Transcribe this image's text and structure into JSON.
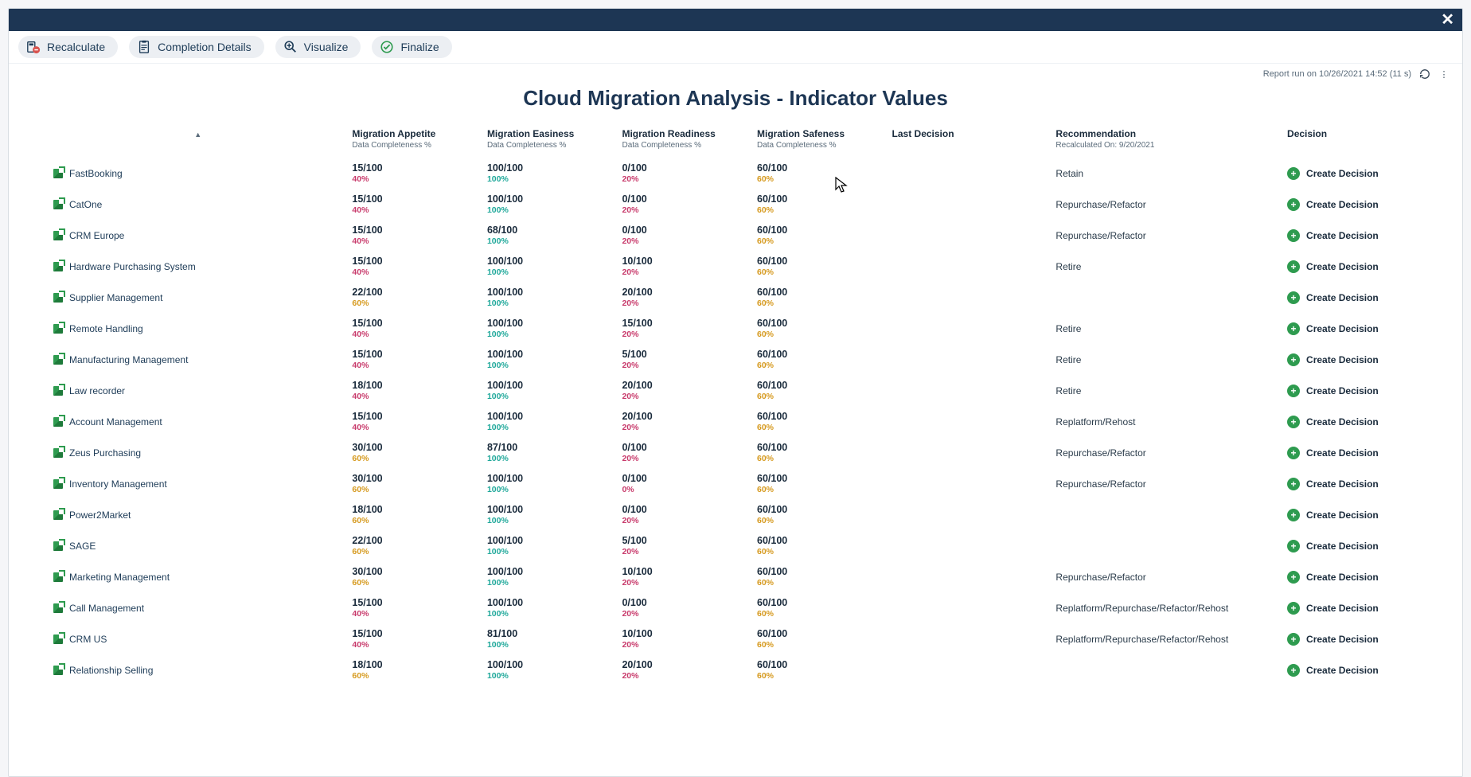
{
  "toolbar": {
    "recalculate": "Recalculate",
    "completion": "Completion Details",
    "visualize": "Visualize",
    "finalize": "Finalize"
  },
  "meta": {
    "report_run": "Report run on 10/26/2021 14:52 (11 s)"
  },
  "title": "Cloud Migration Analysis - Indicator Values",
  "headers": {
    "appetite": "Migration Appetite",
    "easiness": "Migration Easiness",
    "readiness": "Migration Readiness",
    "safeness": "Migration Safeness",
    "sub": "Data Completeness %",
    "last_decision": "Last Decision",
    "recommendation": "Recommendation",
    "rec_sub": "Recalculated On: 9/20/2021",
    "decision": "Decision",
    "create_label": "Create Decision"
  },
  "rows": [
    {
      "name": "FastBooking",
      "appetite": {
        "v": "15/100",
        "p": "40%",
        "cls": "c40"
      },
      "easiness": {
        "v": "100/100",
        "p": "100%",
        "cls": "c100"
      },
      "readiness": {
        "v": "0/100",
        "p": "20%",
        "cls": "c20"
      },
      "safeness": {
        "v": "60/100",
        "p": "60%",
        "cls": "c60"
      },
      "rec": "Retain"
    },
    {
      "name": "CatOne",
      "appetite": {
        "v": "15/100",
        "p": "40%",
        "cls": "c40"
      },
      "easiness": {
        "v": "100/100",
        "p": "100%",
        "cls": "c100"
      },
      "readiness": {
        "v": "0/100",
        "p": "20%",
        "cls": "c20"
      },
      "safeness": {
        "v": "60/100",
        "p": "60%",
        "cls": "c60"
      },
      "rec": "Repurchase/Refactor"
    },
    {
      "name": "CRM Europe",
      "appetite": {
        "v": "15/100",
        "p": "40%",
        "cls": "c40"
      },
      "easiness": {
        "v": "68/100",
        "p": "100%",
        "cls": "c100"
      },
      "readiness": {
        "v": "0/100",
        "p": "20%",
        "cls": "c20"
      },
      "safeness": {
        "v": "60/100",
        "p": "60%",
        "cls": "c60"
      },
      "rec": "Repurchase/Refactor"
    },
    {
      "name": "Hardware Purchasing System",
      "appetite": {
        "v": "15/100",
        "p": "40%",
        "cls": "c40"
      },
      "easiness": {
        "v": "100/100",
        "p": "100%",
        "cls": "c100"
      },
      "readiness": {
        "v": "10/100",
        "p": "20%",
        "cls": "c20"
      },
      "safeness": {
        "v": "60/100",
        "p": "60%",
        "cls": "c60"
      },
      "rec": "Retire"
    },
    {
      "name": "Supplier Management",
      "appetite": {
        "v": "22/100",
        "p": "60%",
        "cls": "c60"
      },
      "easiness": {
        "v": "100/100",
        "p": "100%",
        "cls": "c100"
      },
      "readiness": {
        "v": "20/100",
        "p": "20%",
        "cls": "c20"
      },
      "safeness": {
        "v": "60/100",
        "p": "60%",
        "cls": "c60"
      },
      "rec": ""
    },
    {
      "name": "Remote Handling",
      "appetite": {
        "v": "15/100",
        "p": "40%",
        "cls": "c40"
      },
      "easiness": {
        "v": "100/100",
        "p": "100%",
        "cls": "c100"
      },
      "readiness": {
        "v": "15/100",
        "p": "20%",
        "cls": "c20"
      },
      "safeness": {
        "v": "60/100",
        "p": "60%",
        "cls": "c60"
      },
      "rec": "Retire"
    },
    {
      "name": "Manufacturing Management",
      "appetite": {
        "v": "15/100",
        "p": "40%",
        "cls": "c40"
      },
      "easiness": {
        "v": "100/100",
        "p": "100%",
        "cls": "c100"
      },
      "readiness": {
        "v": "5/100",
        "p": "20%",
        "cls": "c20"
      },
      "safeness": {
        "v": "60/100",
        "p": "60%",
        "cls": "c60"
      },
      "rec": "Retire"
    },
    {
      "name": "Law recorder",
      "appetite": {
        "v": "18/100",
        "p": "40%",
        "cls": "c40"
      },
      "easiness": {
        "v": "100/100",
        "p": "100%",
        "cls": "c100"
      },
      "readiness": {
        "v": "20/100",
        "p": "20%",
        "cls": "c20"
      },
      "safeness": {
        "v": "60/100",
        "p": "60%",
        "cls": "c60"
      },
      "rec": "Retire"
    },
    {
      "name": "Account Management",
      "appetite": {
        "v": "15/100",
        "p": "40%",
        "cls": "c40"
      },
      "easiness": {
        "v": "100/100",
        "p": "100%",
        "cls": "c100"
      },
      "readiness": {
        "v": "20/100",
        "p": "20%",
        "cls": "c20"
      },
      "safeness": {
        "v": "60/100",
        "p": "60%",
        "cls": "c60"
      },
      "rec": "Replatform/Rehost"
    },
    {
      "name": "Zeus Purchasing",
      "appetite": {
        "v": "30/100",
        "p": "60%",
        "cls": "c60"
      },
      "easiness": {
        "v": "87/100",
        "p": "100%",
        "cls": "c100"
      },
      "readiness": {
        "v": "0/100",
        "p": "20%",
        "cls": "c20"
      },
      "safeness": {
        "v": "60/100",
        "p": "60%",
        "cls": "c60"
      },
      "rec": "Repurchase/Refactor"
    },
    {
      "name": "Inventory Management",
      "appetite": {
        "v": "30/100",
        "p": "60%",
        "cls": "c60"
      },
      "easiness": {
        "v": "100/100",
        "p": "100%",
        "cls": "c100"
      },
      "readiness": {
        "v": "0/100",
        "p": "0%",
        "cls": "c0"
      },
      "safeness": {
        "v": "60/100",
        "p": "60%",
        "cls": "c60"
      },
      "rec": "Repurchase/Refactor"
    },
    {
      "name": "Power2Market",
      "appetite": {
        "v": "18/100",
        "p": "60%",
        "cls": "c60"
      },
      "easiness": {
        "v": "100/100",
        "p": "100%",
        "cls": "c100"
      },
      "readiness": {
        "v": "0/100",
        "p": "20%",
        "cls": "c20"
      },
      "safeness": {
        "v": "60/100",
        "p": "60%",
        "cls": "c60"
      },
      "rec": ""
    },
    {
      "name": "SAGE",
      "appetite": {
        "v": "22/100",
        "p": "60%",
        "cls": "c60"
      },
      "easiness": {
        "v": "100/100",
        "p": "100%",
        "cls": "c100"
      },
      "readiness": {
        "v": "5/100",
        "p": "20%",
        "cls": "c20"
      },
      "safeness": {
        "v": "60/100",
        "p": "60%",
        "cls": "c60"
      },
      "rec": ""
    },
    {
      "name": "Marketing Management",
      "appetite": {
        "v": "30/100",
        "p": "60%",
        "cls": "c60"
      },
      "easiness": {
        "v": "100/100",
        "p": "100%",
        "cls": "c100"
      },
      "readiness": {
        "v": "10/100",
        "p": "20%",
        "cls": "c20"
      },
      "safeness": {
        "v": "60/100",
        "p": "60%",
        "cls": "c60"
      },
      "rec": "Repurchase/Refactor"
    },
    {
      "name": "Call Management",
      "appetite": {
        "v": "15/100",
        "p": "40%",
        "cls": "c40"
      },
      "easiness": {
        "v": "100/100",
        "p": "100%",
        "cls": "c100"
      },
      "readiness": {
        "v": "0/100",
        "p": "20%",
        "cls": "c20"
      },
      "safeness": {
        "v": "60/100",
        "p": "60%",
        "cls": "c60"
      },
      "rec": "Replatform/Repurchase/Refactor/Rehost"
    },
    {
      "name": "CRM US",
      "appetite": {
        "v": "15/100",
        "p": "40%",
        "cls": "c40"
      },
      "easiness": {
        "v": "81/100",
        "p": "100%",
        "cls": "c100"
      },
      "readiness": {
        "v": "10/100",
        "p": "20%",
        "cls": "c20"
      },
      "safeness": {
        "v": "60/100",
        "p": "60%",
        "cls": "c60"
      },
      "rec": "Replatform/Repurchase/Refactor/Rehost"
    },
    {
      "name": "Relationship Selling",
      "appetite": {
        "v": "18/100",
        "p": "60%",
        "cls": "c60"
      },
      "easiness": {
        "v": "100/100",
        "p": "100%",
        "cls": "c100"
      },
      "readiness": {
        "v": "20/100",
        "p": "20%",
        "cls": "c20"
      },
      "safeness": {
        "v": "60/100",
        "p": "60%",
        "cls": "c60"
      },
      "rec": ""
    }
  ]
}
